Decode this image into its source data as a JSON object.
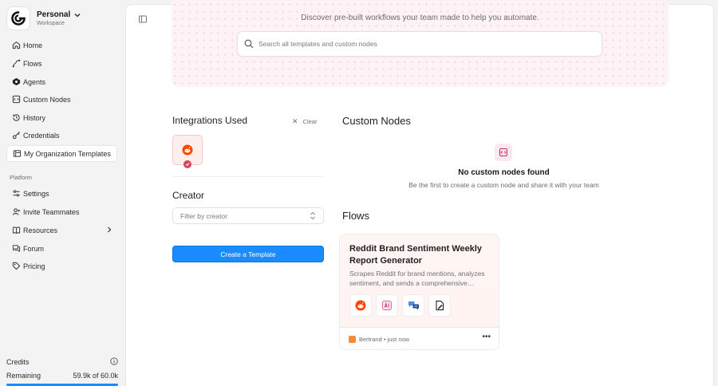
{
  "workspace": {
    "name": "Personal",
    "subtitle": "Workspace"
  },
  "sidebar": {
    "items": [
      {
        "label": "Home",
        "icon": "home-icon"
      },
      {
        "label": "Flows",
        "icon": "flows-icon"
      },
      {
        "label": "Agents",
        "icon": "agents-icon"
      },
      {
        "label": "Custom Nodes",
        "icon": "custom-nodes-icon"
      },
      {
        "label": "History",
        "icon": "history-icon"
      },
      {
        "label": "Credentials",
        "icon": "key-icon"
      },
      {
        "label": "My Organization Templates",
        "icon": "templates-icon",
        "active": true
      }
    ],
    "platform_label": "Platform",
    "platform_items": [
      {
        "label": "Settings",
        "icon": "settings-icon"
      },
      {
        "label": "Invite Teammates",
        "icon": "invite-icon"
      },
      {
        "label": "Resources",
        "icon": "book-icon"
      },
      {
        "label": "Forum",
        "icon": "forum-icon"
      },
      {
        "label": "Pricing",
        "icon": "tag-icon"
      }
    ]
  },
  "credits": {
    "label": "Credits",
    "remaining_label": "Remaining",
    "remaining_value": "59.9k of 60.0k",
    "fraction_used": 0.998
  },
  "hero": {
    "text": "Discover pre-built workflows your team made to help you automate.",
    "search_placeholder": "Search all templates and custom nodes"
  },
  "filters": {
    "integrations_title": "Integrations Used",
    "clear_label": "Clear",
    "creator_title": "Creator",
    "creator_placeholder": "Filter by creator",
    "create_button": "Create a Template"
  },
  "custom_nodes": {
    "title": "Custom Nodes",
    "empty_title": "No custom nodes found",
    "empty_subtitle": "Be the first to create a custom node and share it with your team"
  },
  "flows": {
    "title": "Flows",
    "cards": [
      {
        "title": "Reddit Brand Sentiment Weekly Report Generator",
        "description": "Scrapes Reddit for brand mentions, analyzes sentiment, and sends a comprehensive…",
        "author": "Bertrand • just now"
      }
    ]
  },
  "colors": {
    "accent": "#1a8cff",
    "reddit": "#ff4500",
    "hero_bg": "#fdf2f6"
  }
}
